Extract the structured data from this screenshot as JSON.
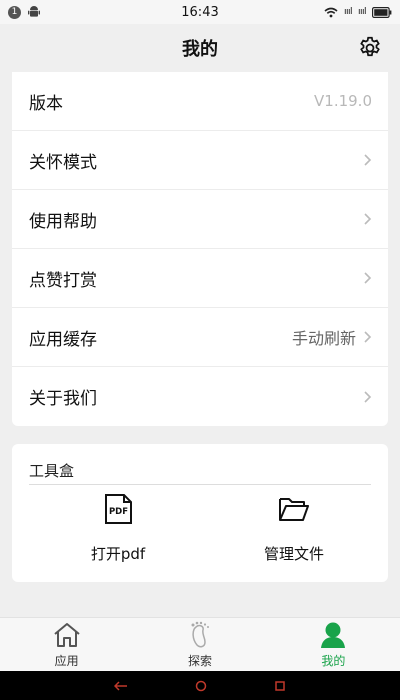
{
  "status_bar": {
    "notification_count": "1",
    "time": "16:43",
    "signal_1": "ıııl",
    "signal_2": "ıııl"
  },
  "header": {
    "title": "我的",
    "settings_icon": "gear-icon"
  },
  "settings": {
    "items": [
      {
        "label": "版本",
        "value": "V1.19.0",
        "chevron": false
      },
      {
        "label": "关怀模式",
        "value": "",
        "chevron": true
      },
      {
        "label": "使用帮助",
        "value": "",
        "chevron": true
      },
      {
        "label": "点赞打赏",
        "value": "",
        "chevron": true
      },
      {
        "label": "应用缓存",
        "value": "手动刷新",
        "chevron": true
      },
      {
        "label": "关于我们",
        "value": "",
        "chevron": true
      }
    ]
  },
  "toolbox": {
    "title": "工具盒",
    "items": [
      {
        "label": "打开pdf",
        "icon": "pdf-icon",
        "icon_text": "PDF"
      },
      {
        "label": "管理文件",
        "icon": "folder-open-icon"
      }
    ]
  },
  "tabbar": {
    "tabs": [
      {
        "label": "应用",
        "icon": "home-icon",
        "active": false
      },
      {
        "label": "探索",
        "icon": "footprint-icon",
        "active": false
      },
      {
        "label": "我的",
        "icon": "user-icon",
        "active": true
      }
    ],
    "active_color": "#19a34a"
  },
  "system_nav": {
    "back_icon": "back-arrow-icon",
    "home_icon": "home-circle-icon",
    "recents_icon": "recents-square-icon"
  }
}
